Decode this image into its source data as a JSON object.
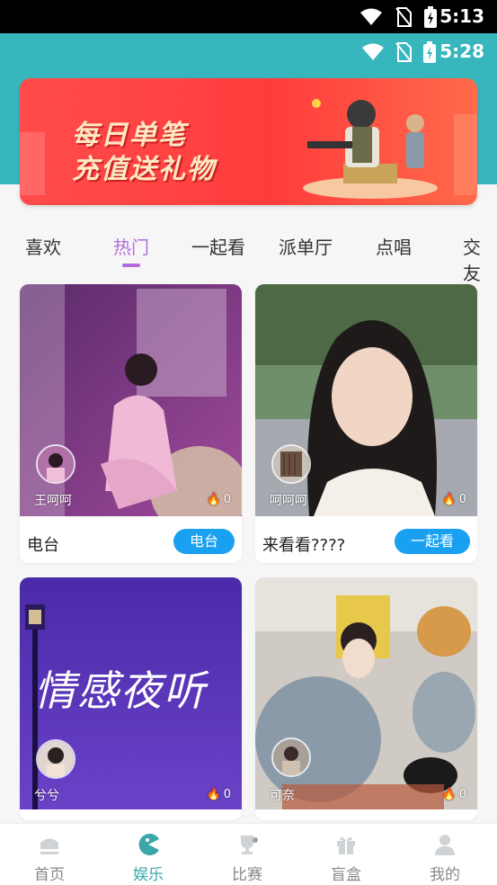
{
  "status_bar": {
    "time": "5:13"
  },
  "app_status_bar": {
    "time": "5:28"
  },
  "banner": {
    "line1": "每日单笔",
    "line2": "充值送礼物"
  },
  "tabs": [
    {
      "label": "喜欢"
    },
    {
      "label": "热门",
      "active": true
    },
    {
      "label": "一起看"
    },
    {
      "label": "派单厅"
    },
    {
      "label": "点唱"
    },
    {
      "label": "交友"
    }
  ],
  "rooms": [
    {
      "host": "王呵呵",
      "heat": "0",
      "title": "电台",
      "tag": "电台"
    },
    {
      "host": "呵呵呵",
      "heat": "0",
      "title": "来看看????",
      "tag": "一起看"
    },
    {
      "host": "兮兮",
      "heat": "0",
      "cover_text": "情感夜听"
    },
    {
      "host": "可奈",
      "heat": "0"
    }
  ],
  "bottom_nav": [
    {
      "label": "首页",
      "icon": "home-icon"
    },
    {
      "label": "娱乐",
      "icon": "pacman-icon",
      "active": true
    },
    {
      "label": "比赛",
      "icon": "trophy-icon"
    },
    {
      "label": "盲盒",
      "icon": "gift-box-icon"
    },
    {
      "label": "我的",
      "icon": "person-icon"
    }
  ],
  "colors": {
    "header_teal": "#38b6bd",
    "tab_active": "#b26be0",
    "tag_blue": "#1aa0f0",
    "nav_active": "#3aa6a8"
  }
}
